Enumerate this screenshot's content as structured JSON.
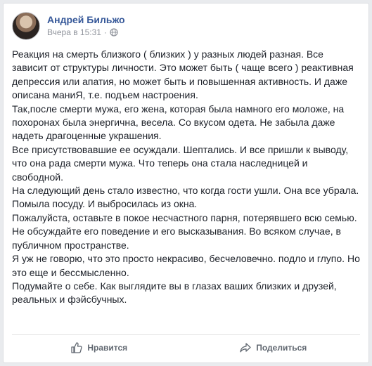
{
  "post": {
    "author": "Андрей Бильжо",
    "timestamp": "Вчера в 15:31",
    "separator": "·",
    "audience_icon": "globe-icon",
    "paragraphs": [
      "Реакция на смерть близкого ( близких ) у разных людей разная. Все зависит от структуры личности. Это может быть ( чаще всего ) реактивная депрессия или апатия, но может быть и повышенная активность. И даже описана маниЯ, т.е. подъем настроения.",
      "Так,после смерти мужа, его жена, которая была намного его моложе, на похоронах была энергична, весела. Со вкусом одета. Не забыла даже надеть драгоценные украшения.",
      "Все присутствовавшие ее осуждали. Шептались. И все пришли к выводу, что она рада смерти мужа. Что теперь она стала наследницей и свободной.",
      "На следующий день стало известно, что когда гости ушли. Она все убрала. Помыла посуду. И выбросилась из окна.",
      "Пожалуйста, оставьте в покое несчастного парня, потерявшего всю семью.",
      "Не обсуждайте его поведение и его высказывания. Во всяком случае, в публичном пространстве.",
      "Я уж не говорю, что это просто некрасиво, бесчеловечно. подло и глупо. Но это еще и бессмысленно.",
      "Подумайте о себе. Как выглядите вы в глазах ваших близких и друзей, реальных и фэйсбучных."
    ]
  },
  "actions": {
    "like_label": "Нравится",
    "like_icon": "thumbs-up-icon",
    "share_label": "Поделиться",
    "share_icon": "share-arrow-icon"
  },
  "colors": {
    "author_link": "#365899",
    "meta_text": "#90949c",
    "body_text": "#1d2129",
    "action_text": "#606770",
    "page_background": "#e9ebee"
  }
}
